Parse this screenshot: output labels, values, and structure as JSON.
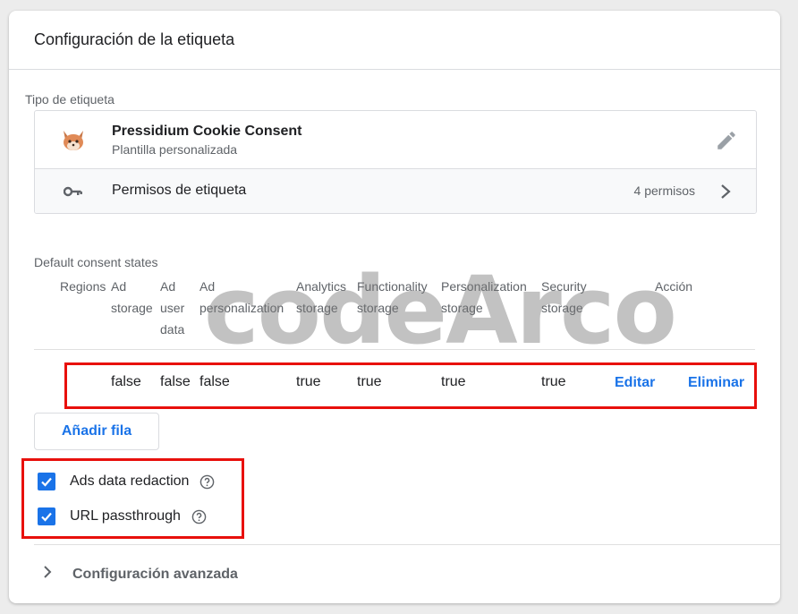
{
  "header": {
    "title": "Configuración de la etiqueta"
  },
  "tag_type": {
    "section_label": "Tipo de etiqueta",
    "template_name": "Pressidium Cookie Consent",
    "template_subtitle": "Plantilla personalizada",
    "template_icon": "fox-icon",
    "edit_icon": "pencil-icon",
    "permissions_label": "Permisos de etiqueta",
    "permissions_count": "4 permisos",
    "permissions_icon": "key-icon"
  },
  "consent": {
    "section_label": "Default consent states",
    "columns": [
      {
        "key": "regions",
        "lines": [
          "Regions"
        ]
      },
      {
        "key": "ad_storage",
        "lines": [
          "Ad",
          "storage"
        ]
      },
      {
        "key": "ad_user_data",
        "lines": [
          "Ad",
          "user",
          "data"
        ]
      },
      {
        "key": "ad_personalization",
        "lines": [
          "Ad",
          "personalization"
        ]
      },
      {
        "key": "analytics_storage",
        "lines": [
          "Analytics",
          "storage"
        ]
      },
      {
        "key": "functionality_storage",
        "lines": [
          "Functionality",
          "storage"
        ]
      },
      {
        "key": "personalization_storage",
        "lines": [
          "Personalization",
          "storage"
        ]
      },
      {
        "key": "security_storage",
        "lines": [
          "Security",
          "storage"
        ]
      },
      {
        "key": "action",
        "lines": [
          "Acción"
        ]
      }
    ],
    "rows": [
      {
        "regions": "",
        "ad_storage": "false",
        "ad_user_data": "false",
        "ad_personalization": "false",
        "analytics_storage": "true",
        "functionality_storage": "true",
        "personalization_storage": "true",
        "security_storage": "true",
        "edit_label": "Editar",
        "delete_label": "Eliminar"
      }
    ],
    "add_row_label": "Añadir fila"
  },
  "options": [
    {
      "label": "Ads data redaction",
      "checked": true
    },
    {
      "label": "URL passthrough",
      "checked": true
    }
  ],
  "advanced": {
    "label": "Configuración avanzada"
  },
  "watermark": "codeArco",
  "colors": {
    "accent": "#1a73e8",
    "highlight": "#e8100c"
  }
}
